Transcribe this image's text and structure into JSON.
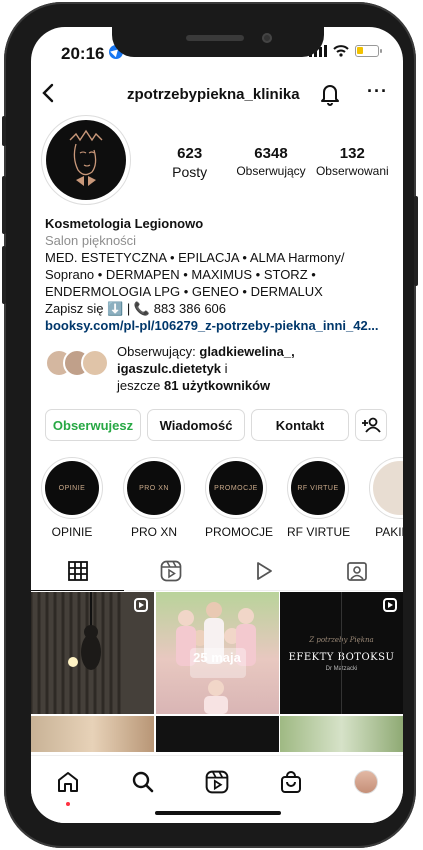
{
  "status": {
    "time": "20:16"
  },
  "header": {
    "username": "zpotrzebypiekna_klinika"
  },
  "stats": [
    {
      "value": "623",
      "label": "Posty"
    },
    {
      "value": "6348",
      "label": "Obserwujący"
    },
    {
      "value": "132",
      "label": "Obserwowani"
    }
  ],
  "bio": {
    "name": "Kosmetologia Legionowo",
    "category": "Salon piękności",
    "line1": "MED. ESTETYCZNA • EPILACJA • ALMA Harmony/",
    "line2": "Soprano • DERMAPEN • MAXIMUS • STORZ •",
    "line3": "ENDERMOLOGIA LPG • GENEO • DERMALUX",
    "line4": "Zapisz się ⬇️ | 📞 883 386 606",
    "link": "booksy.com/pl-pl/106279_z-potrzeby-piekna_inni_42..."
  },
  "followers": {
    "prefix": "Obserwujący: ",
    "names": "gladkiewelina_,",
    "name2": "igaszulc.dietetyk",
    "and": " i",
    "more_prefix": "jeszcze ",
    "more_count": "81 użytkowników"
  },
  "actions": {
    "follow": "Obserwujesz",
    "message": "Wiadomość",
    "contact": "Kontakt"
  },
  "highlights": [
    {
      "label": "OPINIE",
      "cover": "OPINIE"
    },
    {
      "label": "PRO XN",
      "cover": "PRO XN"
    },
    {
      "label": "PROMOCJE",
      "cover": "PROMOCJE"
    },
    {
      "label": "RF VIRTUE",
      "cover": "RF VIRTUE"
    },
    {
      "label": "PAKIETY",
      "cover": ""
    }
  ],
  "posts": {
    "p2_text": "25 maja",
    "p3_title": "EFEKTY BOTOKSU",
    "p3_sub": "Dr Matzacki",
    "p3_script": "Z potrzeby Piękna"
  },
  "colors": {
    "follow_green": "#27a844",
    "link_blue": "#00376b",
    "notify_red": "#ff3040"
  }
}
